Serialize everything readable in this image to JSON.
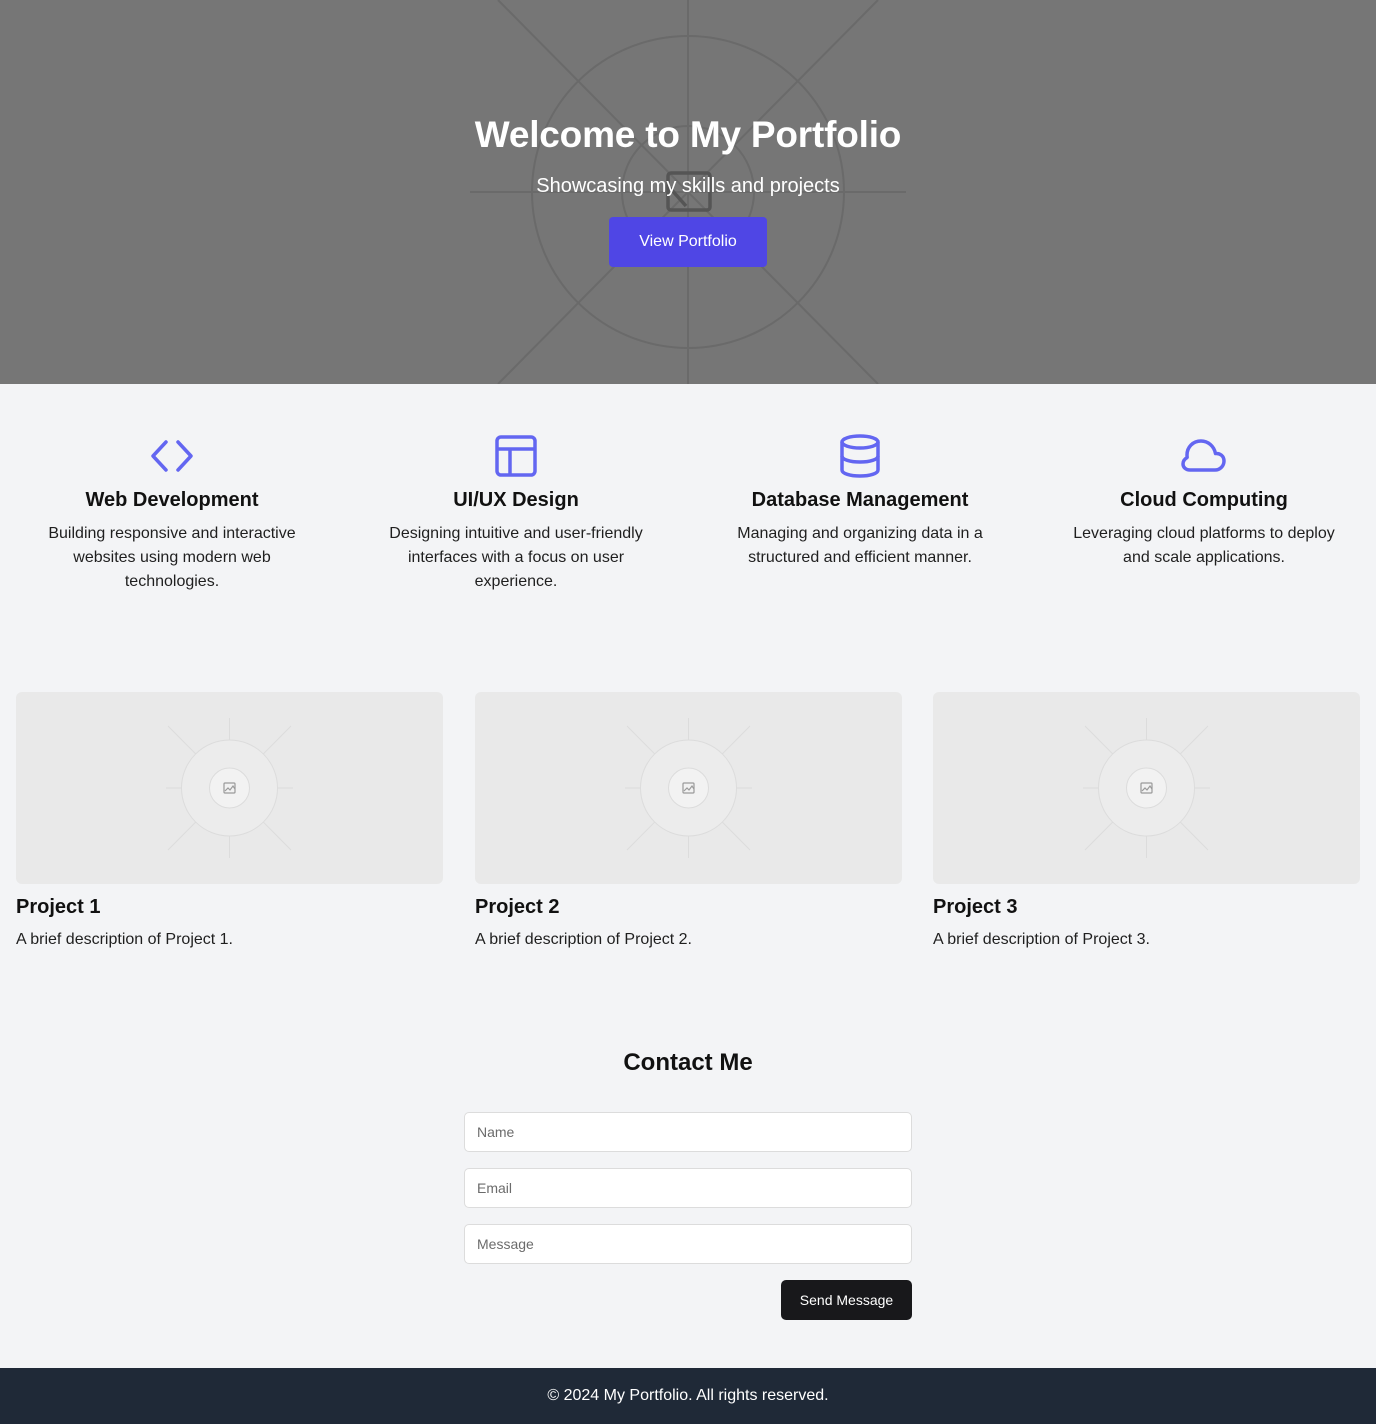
{
  "hero": {
    "title": "Welcome to My Portfolio",
    "subtitle": "Showcasing my skills and projects",
    "button_label": "View Portfolio"
  },
  "features": [
    {
      "icon": "code-icon",
      "title": "Web Development",
      "description": "Building responsive and interactive websites using modern web technologies."
    },
    {
      "icon": "layout-icon",
      "title": "UI/UX Design",
      "description": "Designing intuitive and user-friendly interfaces with a focus on user experience."
    },
    {
      "icon": "database-icon",
      "title": "Database Management",
      "description": "Managing and organizing data in a structured and efficient manner."
    },
    {
      "icon": "cloud-icon",
      "title": "Cloud Computing",
      "description": "Leveraging cloud platforms to deploy and scale applications."
    }
  ],
  "projects": [
    {
      "title": "Project 1",
      "description": "A brief description of Project 1."
    },
    {
      "title": "Project 2",
      "description": "A brief description of Project 2."
    },
    {
      "title": "Project 3",
      "description": "A brief description of Project 3."
    }
  ],
  "contact": {
    "title": "Contact Me",
    "name_placeholder": "Name",
    "email_placeholder": "Email",
    "message_placeholder": "Message",
    "send_label": "Send Message"
  },
  "footer": {
    "text": "© 2024 My Portfolio. All rights reserved."
  },
  "colors": {
    "accent": "#4f46e5",
    "icon": "#6366f1",
    "hero_bg": "#767676",
    "page_bg": "#f3f4f6",
    "footer_bg": "#1f2937",
    "send_button": "#18181b"
  }
}
